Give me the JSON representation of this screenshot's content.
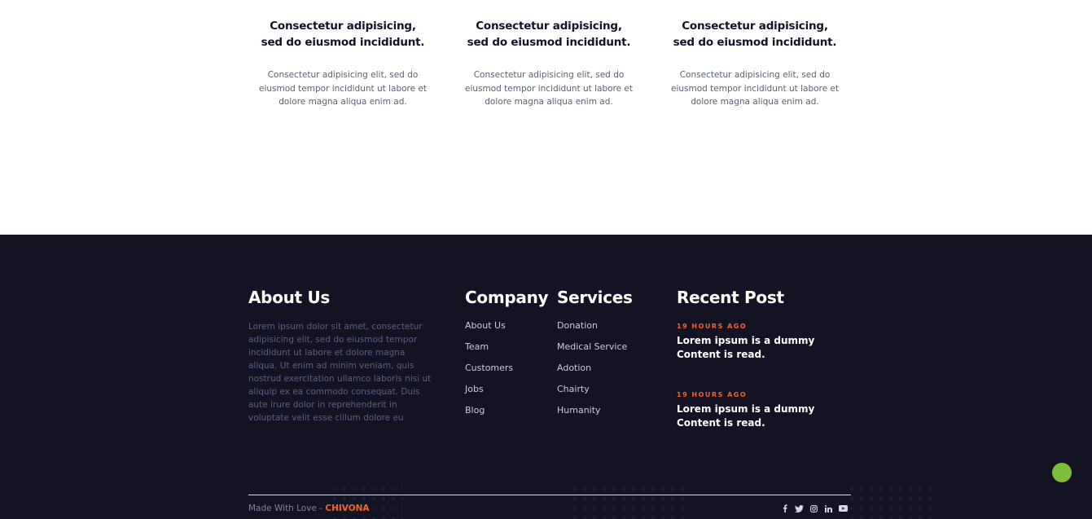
{
  "features": [
    {
      "title": "Consectetur adipisicing, sed do eiusmod incididunt.",
      "text": "Consectetur adipisicing elit, sed do eiusmod tempor incididunt ut labore et dolore magna aliqua enim ad."
    },
    {
      "title": "Consectetur adipisicing, sed do eiusmod incididunt.",
      "text": "Consectetur adipisicing elit, sed do eiusmod tempor incididunt ut labore et dolore magna aliqua enim ad."
    },
    {
      "title": "Consectetur adipisicing, sed do eiusmod incididunt.",
      "text": "Consectetur adipisicing elit, sed do eiusmod tempor incididunt ut labore et dolore magna aliqua enim ad."
    }
  ],
  "footer": {
    "about": {
      "title": "About Us",
      "text": "Lorem ipsum dolor sit amet, consectetur adipisicing elit, sed do eiusmod tempor incididunt ut labore et dolore magna aliqua. Ut enim ad minim veniam, quis nostrud exercitation ullamco laboris nisi ut aliquip ex ea commodo consequat. Duis aute irure dolor in reprehenderit in voluptate velit esse cillum dolore eu"
    },
    "company": {
      "title": "Company",
      "links": [
        "About Us",
        "Team",
        "Customers",
        "Jobs",
        "Blog"
      ]
    },
    "services": {
      "title": "Services",
      "links": [
        "Donation",
        "Medical Service",
        "Adotion",
        "Chairty",
        "Humanity"
      ]
    },
    "recent": {
      "title": "Recent Post",
      "posts": [
        {
          "time": "19 HOURS AGO",
          "title": "Lorem ipsum is a dummy Content is read."
        },
        {
          "time": "19 HOURS AGO",
          "title": "Lorem ipsum is a dummy Content is read."
        }
      ]
    },
    "copyright": {
      "prefix": "Made With Love - ",
      "brand": "CHIVONA"
    },
    "socials": [
      "facebook-icon",
      "twitter-icon",
      "instagram-icon",
      "linkedin-icon",
      "youtube-icon"
    ]
  },
  "colors": {
    "footer_bg": "#131324",
    "accent": "#f0652f",
    "scroll_top": "#7cbd3a"
  }
}
